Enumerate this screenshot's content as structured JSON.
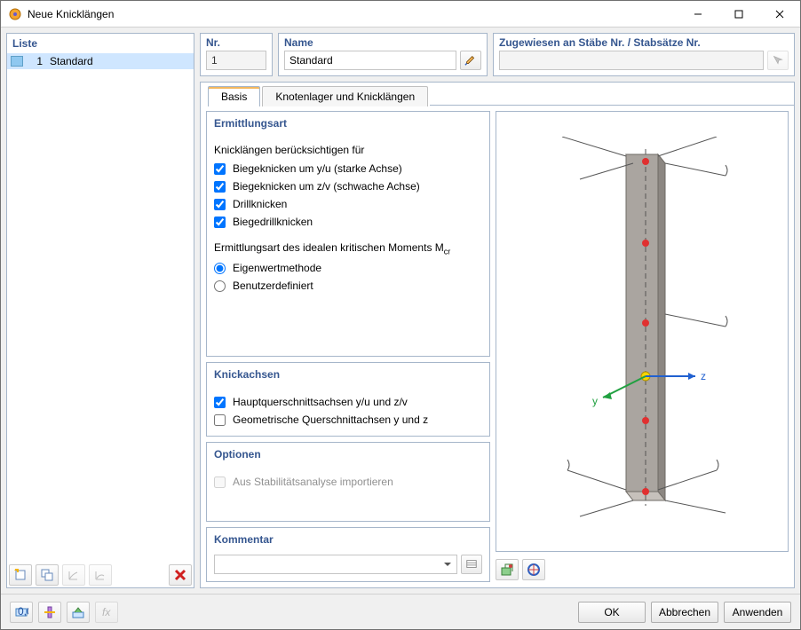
{
  "window": {
    "title": "Neue Knicklängen",
    "minimize": "minimize",
    "maximize": "maximize",
    "close": "close"
  },
  "list": {
    "header": "Liste",
    "items": [
      {
        "num": "1",
        "label": "Standard",
        "selected": true
      }
    ]
  },
  "left_toolbar": {
    "new": "new",
    "copy": "copy",
    "tool3": "axes-tool-a",
    "tool4": "axes-tool-b",
    "delete": "delete"
  },
  "fields": {
    "nr": {
      "label": "Nr.",
      "value": "1"
    },
    "name": {
      "label": "Name",
      "value": "Standard"
    },
    "assigned": {
      "label": "Zugewiesen an Stäbe Nr. / Stabsätze Nr.",
      "value": ""
    }
  },
  "tabs": {
    "basis": "Basis",
    "nodal": "Knotenlager und Knicklängen"
  },
  "groups": {
    "ermittlungsart": {
      "title": "Ermittlungsart",
      "consider_label": "Knicklängen berücksichtigen für",
      "ck1": "Biegeknicken um y/u (starke Achse)",
      "ck2": "Biegeknicken um z/v (schwache Achse)",
      "ck3": "Drillknicken",
      "ck4": "Biegedrillknicken",
      "moment_label_pre": "Ermittlungsart des idealen kritischen Moments M",
      "moment_label_sub": "cr",
      "r1": "Eigenwertmethode",
      "r2": "Benutzerdefiniert"
    },
    "knickachsen": {
      "title": "Knickachsen",
      "ck1": "Hauptquerschnittsachsen y/u und z/v",
      "ck2": "Geometrische Querschnittachsen y und z"
    },
    "optionen": {
      "title": "Optionen",
      "ck1": "Aus Stabilitätsanalyse importieren"
    },
    "kommentar": {
      "title": "Kommentar",
      "value": ""
    }
  },
  "preview": {
    "axis_y": "y",
    "axis_z": "z"
  },
  "footer": {
    "ok": "OK",
    "cancel": "Abbrechen",
    "apply": "Anwenden"
  }
}
